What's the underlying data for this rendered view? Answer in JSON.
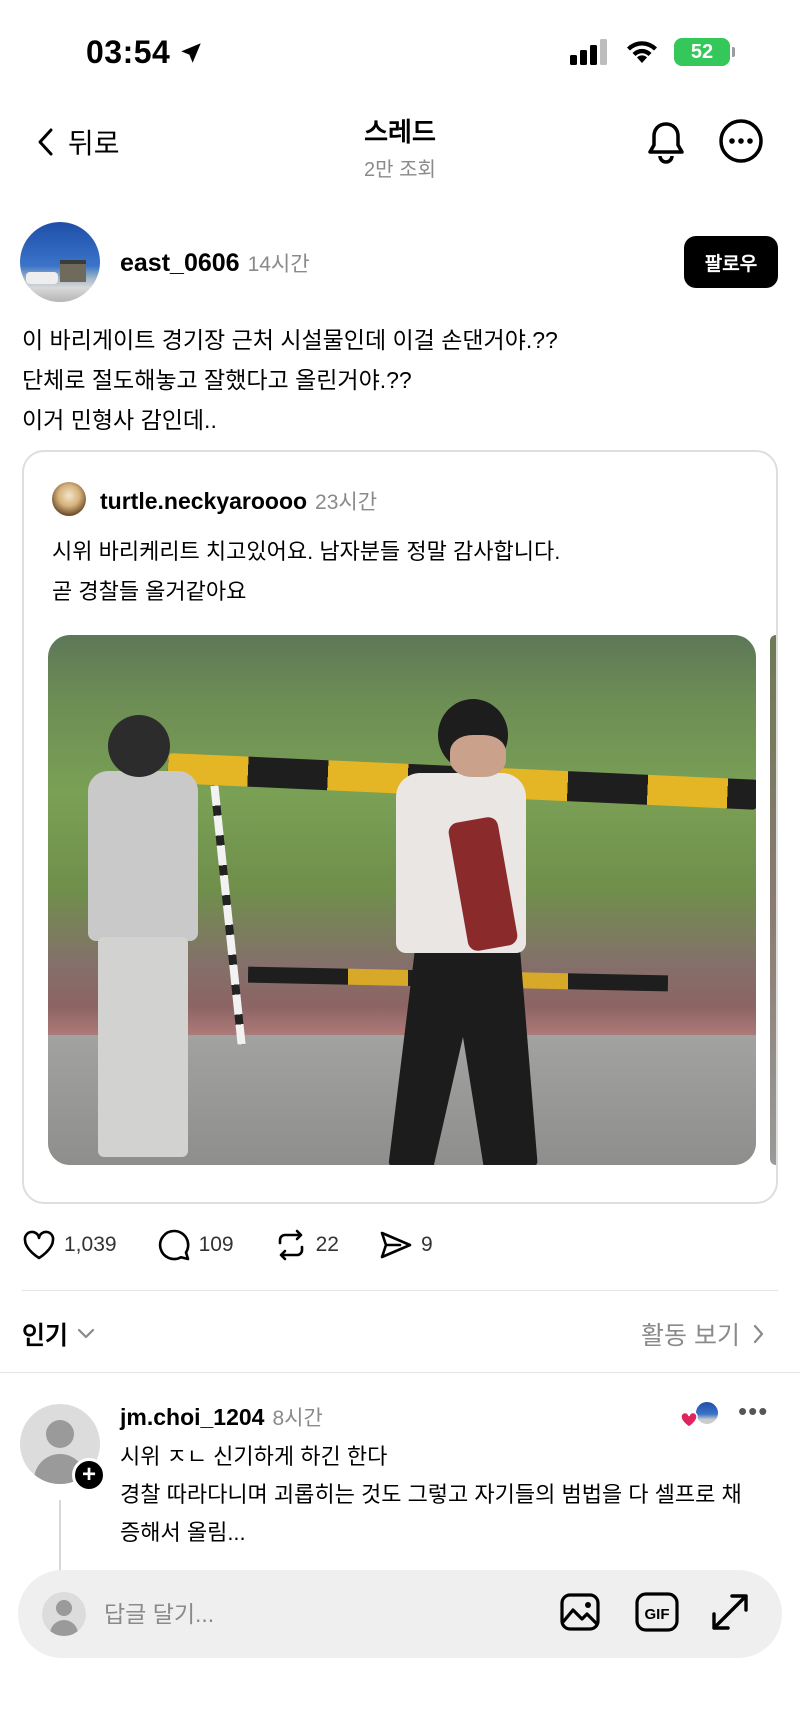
{
  "status_bar": {
    "time": "03:54",
    "battery": "52"
  },
  "nav": {
    "back_label": "뒤로",
    "title": "스레드",
    "subtitle": "2만 조회"
  },
  "post": {
    "username": "east_0606",
    "time": "14시간",
    "follow_label": "팔로우",
    "lines": [
      "이 바리게이트 경기장 근처 시설물인데 이걸 손댄거야.??",
      "단체로 절도해놓고 잘했다고 올린거야.??",
      "이거 민형사 감인데.."
    ]
  },
  "quoted_post": {
    "username": "turtle.neckyaroooo",
    "time": "23시간",
    "lines": [
      "시위 바리케리트 치고있어요. 남자분들 정말 감사합니다.",
      "곧 경찰들 올거같아요"
    ]
  },
  "actions": {
    "likes": "1,039",
    "comments": "109",
    "reposts": "22",
    "shares": "9"
  },
  "sort": {
    "label": "인기",
    "activity_label": "활동 보기"
  },
  "comment": {
    "username": "jm.choi_1204",
    "time": "8시간",
    "lines": [
      "시위 ㅈㄴ 신기하게 하긴 한다",
      "경찰 따라다니며 괴롭히는 것도 그렇고 자기들의 범법을 다 셀프로 채",
      "증해서 올림..."
    ],
    "more": "•••"
  },
  "reply_bar": {
    "placeholder": "답글 달기..."
  },
  "colors": {
    "accent": "#000000",
    "battery": "#34c759",
    "heart": "#e0245e",
    "muted": "#8a8a8a"
  }
}
